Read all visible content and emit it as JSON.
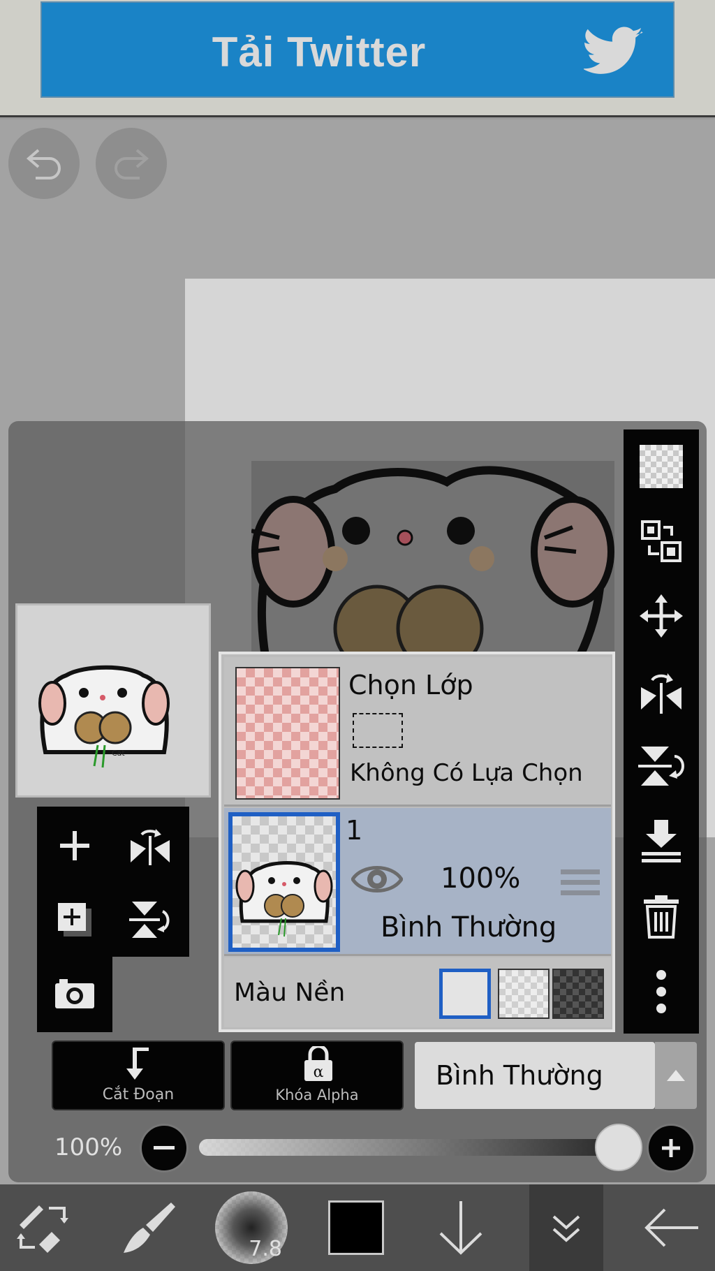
{
  "ad": {
    "label": "Tải Twitter",
    "icon": "twitter-bird-icon",
    "color": "#1a83c6"
  },
  "history": {
    "undo_icon": "undo-icon",
    "redo_icon": "redo-icon"
  },
  "right_toolbar": [
    {
      "name": "transparent-bg-icon"
    },
    {
      "name": "swap-layer-icon"
    },
    {
      "name": "move-icon"
    },
    {
      "name": "flip-horizontal-icon"
    },
    {
      "name": "flip-vertical-icon"
    },
    {
      "name": "merge-down-icon"
    },
    {
      "name": "trash-icon"
    },
    {
      "name": "more-vertical-icon"
    }
  ],
  "left_tools": [
    {
      "name": "add-layer-icon"
    },
    {
      "name": "flip-layer-horizontal-icon"
    },
    {
      "name": "duplicate-layer-icon"
    },
    {
      "name": "flip-layer-vertical-icon"
    },
    {
      "name": "camera-icon"
    }
  ],
  "layers": {
    "selection": {
      "title": "Chọn Lớp",
      "status": "Không Có Lựa Chọn"
    },
    "layer1": {
      "number": "1",
      "opacity": "100%",
      "blend": "Bình Thường"
    },
    "background": {
      "label": "Màu Nền",
      "options": [
        "white",
        "transparent",
        "dark"
      ],
      "selected": "white"
    }
  },
  "actions": {
    "clipping": "Cắt Đoạn",
    "alpha_lock": "Khóa Alpha",
    "blend_mode": "Bình Thường"
  },
  "opacity": {
    "label": "100%",
    "value": 1.0
  },
  "bottom_bar": {
    "brush_size": "7.8",
    "color": "#000000"
  }
}
